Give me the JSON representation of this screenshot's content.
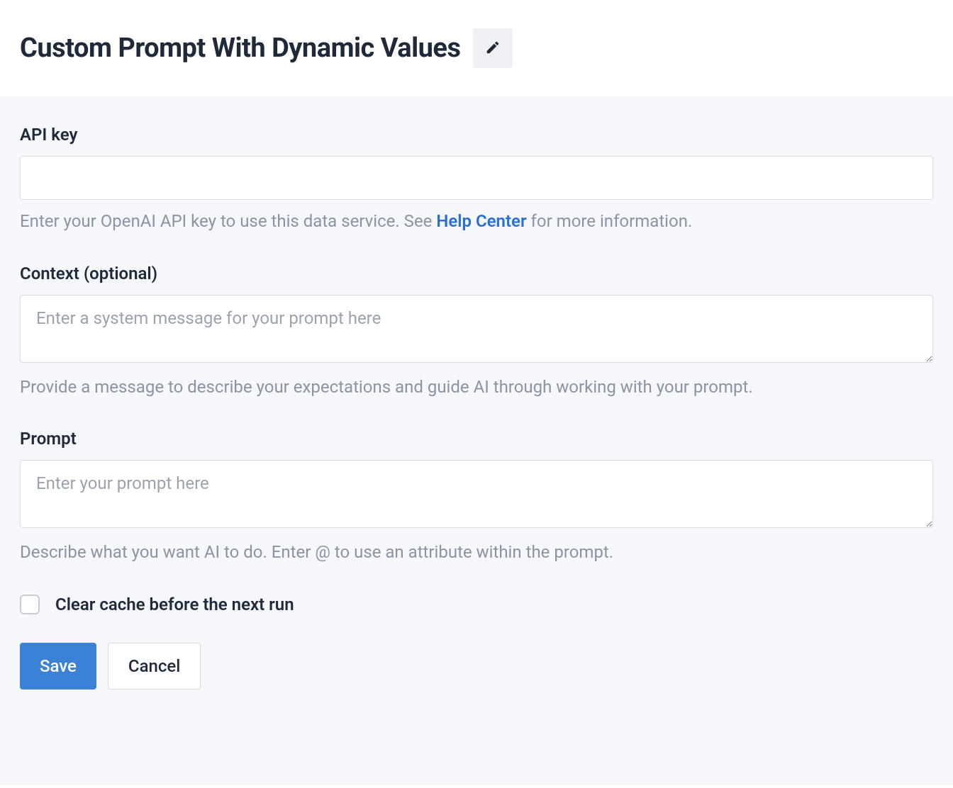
{
  "header": {
    "title": "Custom Prompt With Dynamic Values"
  },
  "fields": {
    "api_key": {
      "label": "API key",
      "value": "",
      "help_before": "Enter your OpenAI API key to use this data service. See ",
      "help_link": "Help Center",
      "help_after": " for more information."
    },
    "context": {
      "label": "Context (optional)",
      "placeholder": "Enter a system message for your prompt here",
      "value": "",
      "help": "Provide a message to describe your expectations and guide AI through working with your prompt."
    },
    "prompt": {
      "label": "Prompt",
      "placeholder": "Enter your prompt here",
      "value": "",
      "help": "Describe what you want AI to do. Enter @ to use an attribute within the prompt."
    },
    "clear_cache": {
      "label": "Clear cache before the next run"
    }
  },
  "buttons": {
    "save": "Save",
    "cancel": "Cancel"
  }
}
